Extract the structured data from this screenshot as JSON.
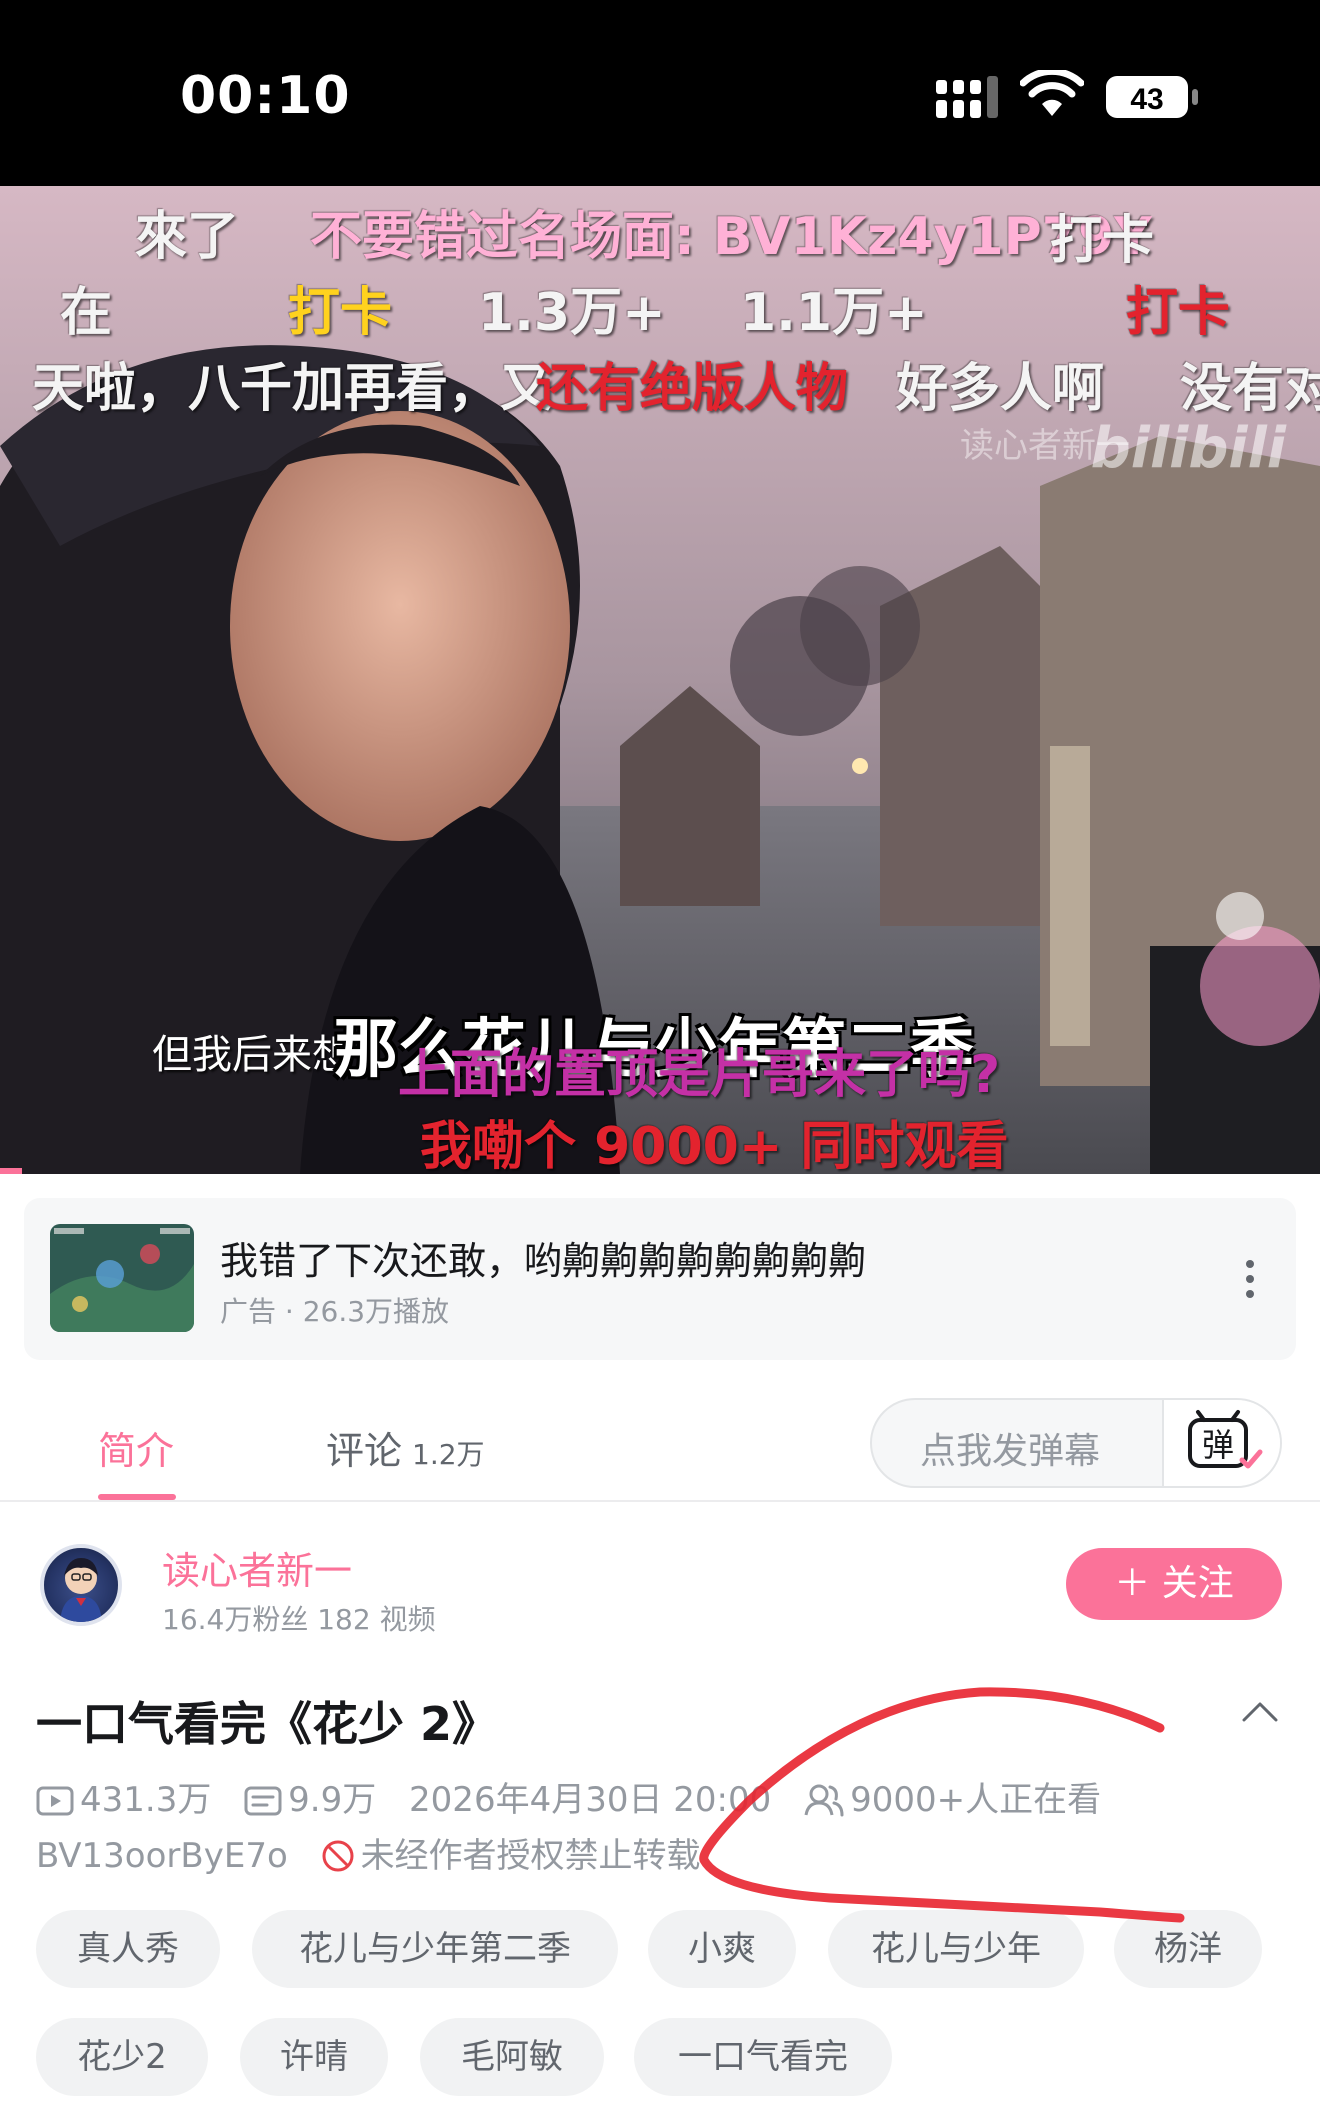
{
  "status_bar": {
    "time": "00:10",
    "battery": "43"
  },
  "video": {
    "danmaku": [
      "來了",
      "不要错过名场面: BV1Kz4y1P79Y",
      "打卡",
      "在",
      "打卡",
      "1.3万+",
      "1.1万+",
      "打卡",
      "天啦，八千加再看，又",
      "还有绝版人物",
      "好多人啊",
      "没有对",
      "上面的置顶是片哥来了吗?",
      "我嘞个 9000+ 同时观看"
    ],
    "subtitle_small": "但我后来想",
    "subtitle_main": "那么花儿与少年第二季",
    "watermark_uploader": "读心者新一",
    "watermark_logo": "bilibili"
  },
  "ad": {
    "title": "我错了下次还敢，哟齁齁齁齁齁齁齁齁",
    "subtitle": "广告 · 26.3万播放"
  },
  "tabs": {
    "intro": "简介",
    "comments": "评论",
    "comments_count": "1.2万",
    "danmu_placeholder": "点我发弹幕",
    "danmu_button": "弹"
  },
  "uploader": {
    "name": "读心者新一",
    "stats": "16.4万粉丝  182 视频",
    "follow_label": "＋ 关注"
  },
  "video_info": {
    "title": "一口气看完《花少 2》",
    "views": "431.3万",
    "danmaku_count": "9.9万",
    "date": "2026年4月30日 20:00",
    "watching": "9000+人正在看",
    "bvid": "BV13oorByE7o",
    "notice": "未经作者授权禁止转载"
  },
  "tags": [
    "真人秀",
    "花儿与少年第二季",
    "小爽",
    "花儿与少年",
    "杨洋",
    "花少2",
    "许晴",
    "毛阿敏",
    "一口气看完"
  ],
  "colors": {
    "accent": "#fb7299",
    "muted": "#9499a0",
    "scribble": "#e8242f"
  }
}
